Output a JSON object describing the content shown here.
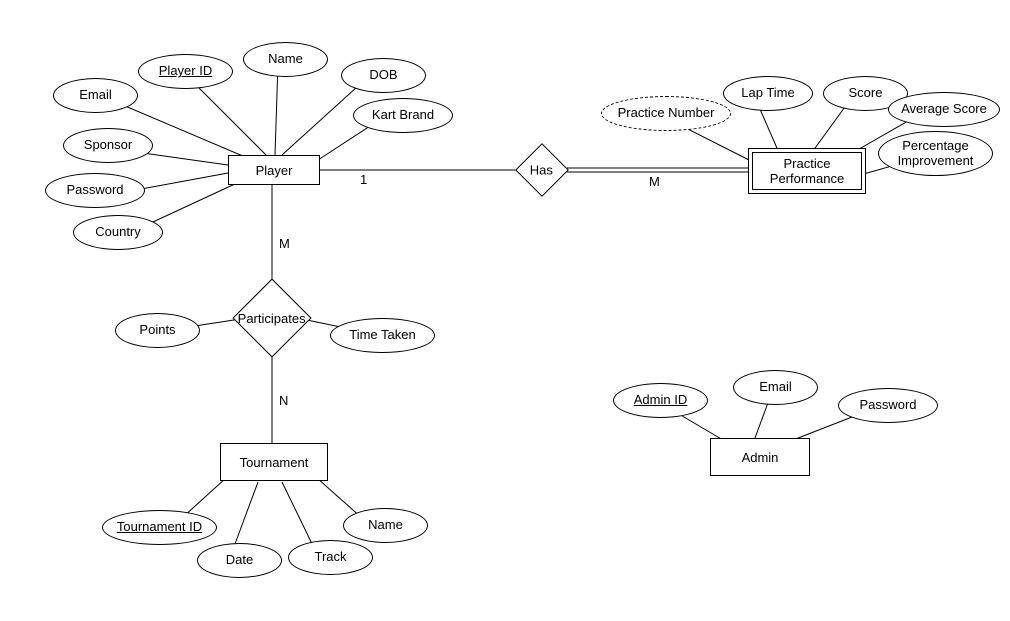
{
  "entities": {
    "player": {
      "label": "Player",
      "attrs": {
        "email": "Email",
        "player_id": "Player ID",
        "name": "Name",
        "dob": "DOB",
        "kart_brand": "Kart Brand",
        "sponsor": "Sponsor",
        "password": "Password",
        "country": "Country"
      }
    },
    "practice_performance": {
      "label": "Practice\nPerformance",
      "attrs": {
        "practice_number": "Practice Number",
        "lap_time": "Lap Time",
        "score": "Score",
        "average_score": "Average Score",
        "percentage_improvement": "Percentage\nImprovement"
      }
    },
    "tournament": {
      "label": "Tournament",
      "attrs": {
        "tournament_id": "Tournament ID",
        "date": "Date",
        "track": "Track",
        "name": "Name"
      }
    },
    "admin": {
      "label": "Admin",
      "attrs": {
        "admin_id": "Admin ID",
        "email": "Email",
        "password": "Password"
      }
    }
  },
  "relationships": {
    "has": {
      "label": "Has",
      "left_card": "1",
      "right_card": "M"
    },
    "participates": {
      "label": "Participates",
      "top_card": "M",
      "bottom_card": "N",
      "attrs": {
        "points": "Points",
        "time_taken": "Time Taken"
      }
    }
  }
}
